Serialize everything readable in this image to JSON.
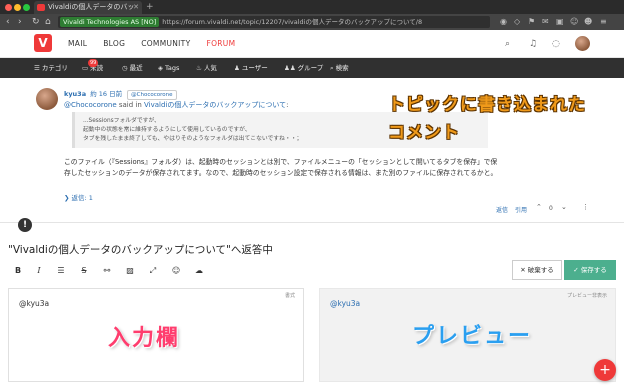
{
  "browser": {
    "tab_title": "Vivaldiの個人データのバッ",
    "url_badge": "Vivaldi Technologies AS [NO]",
    "url": "https://forum.vivaldi.net/topic/12207/vivaldiの個人データのバックアップについて/8"
  },
  "site": {
    "logo": "V",
    "nav": [
      "MAIL",
      "BLOG",
      "COMMUNITY",
      "FORUM"
    ]
  },
  "forum_nav": {
    "items": [
      "カテゴリ",
      "未読",
      "最近",
      "Tags",
      "人気",
      "ユーザー",
      "グループ",
      "検索"
    ],
    "unread_count": "99"
  },
  "post": {
    "username": "kyu3a",
    "time": "約 16 日前",
    "reply_to": "@Chococorone",
    "said_user": "@Chococorone",
    "said_in": "said in",
    "said_topic": "Vivaldiの個人データのバックアップについて",
    "said_colon": ":",
    "quote_lines": [
      "...Sessionsフォルダですが、",
      "起動中の状態を常に維持するようにして使用しているのですが、",
      "タブを残したまま終了しても、やはりそのようなフォルダは出てこないですね・・；"
    ],
    "body": "このファイル（『Sessions』フォルダ）は、起動時のセッションとは別で、ファイルメニューの「セッションとして開いてるタブを保存」で保存したセッションのデータが保存されてます。なので、起動時のセッション設定で保存される情報は、また別のファイルに保存されてるかと。",
    "replies": "返信: 1",
    "actions": {
      "reply": "返信",
      "quote": "引用",
      "votes": "0"
    }
  },
  "annotations": {
    "comment_line1": "トピックに書き込まれた",
    "comment_line2": "コメント",
    "input_area": "入力欄",
    "preview_area": "プレビュー"
  },
  "composer": {
    "title": "\"Vivaldiの個人データのバックアップについて\"へ返答中",
    "discard": "破棄する",
    "submit": "保存する",
    "editor_value": "@kyu3a",
    "editor_hint": "書式",
    "preview_value": "@kyu3a",
    "preview_hint": "プレビュー非表示"
  },
  "colors": {
    "brand": "#ef3939",
    "submit": "#4caf8e",
    "link": "#2a6db0"
  }
}
